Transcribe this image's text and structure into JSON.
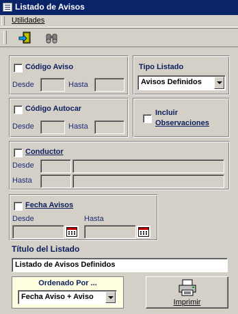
{
  "window": {
    "title": "Listado de Avisos"
  },
  "menu": {
    "items": [
      {
        "label": "Utilidades"
      }
    ]
  },
  "toolbar": {
    "buttons": [
      {
        "icon": "exit-door-icon"
      },
      {
        "icon": "binoculars-icon"
      }
    ]
  },
  "codigo_aviso": {
    "label": "Código Aviso",
    "checked": false,
    "desde_label": "Desde",
    "hasta_label": "Hasta",
    "desde_value": "",
    "hasta_value": ""
  },
  "tipo_listado": {
    "label": "Tipo Listado",
    "selected": "Avisos Definidos"
  },
  "codigo_autocar": {
    "label": "Código Autocar",
    "checked": false,
    "desde_label": "Desde",
    "hasta_label": "Hasta",
    "desde_value": "",
    "hasta_value": ""
  },
  "incluir_observaciones": {
    "label_line1": "Incluir",
    "label_line2": "Observaciones",
    "checked": false
  },
  "conductor": {
    "label": "Conductor",
    "checked": false,
    "desde_label": "Desde",
    "hasta_label": "Hasta"
  },
  "fecha_avisos": {
    "label": "Fecha Avisos",
    "checked": false,
    "desde_label": "Desde",
    "hasta_label": "Hasta",
    "desde_value": "",
    "hasta_value": ""
  },
  "titulo": {
    "label": "Título del Listado",
    "value": "Listado de Avisos Definidos"
  },
  "ordenado": {
    "label": "Ordenado Por ...",
    "selected": "Fecha Aviso + Aviso"
  },
  "imprimir": {
    "label": "Imprimir",
    "icon": "printer-icon"
  },
  "colors": {
    "titlebar": "#0a246a",
    "face": "#d4d0c8",
    "label_blue": "#0a1e5e",
    "order_bg": "#ffffe1"
  }
}
